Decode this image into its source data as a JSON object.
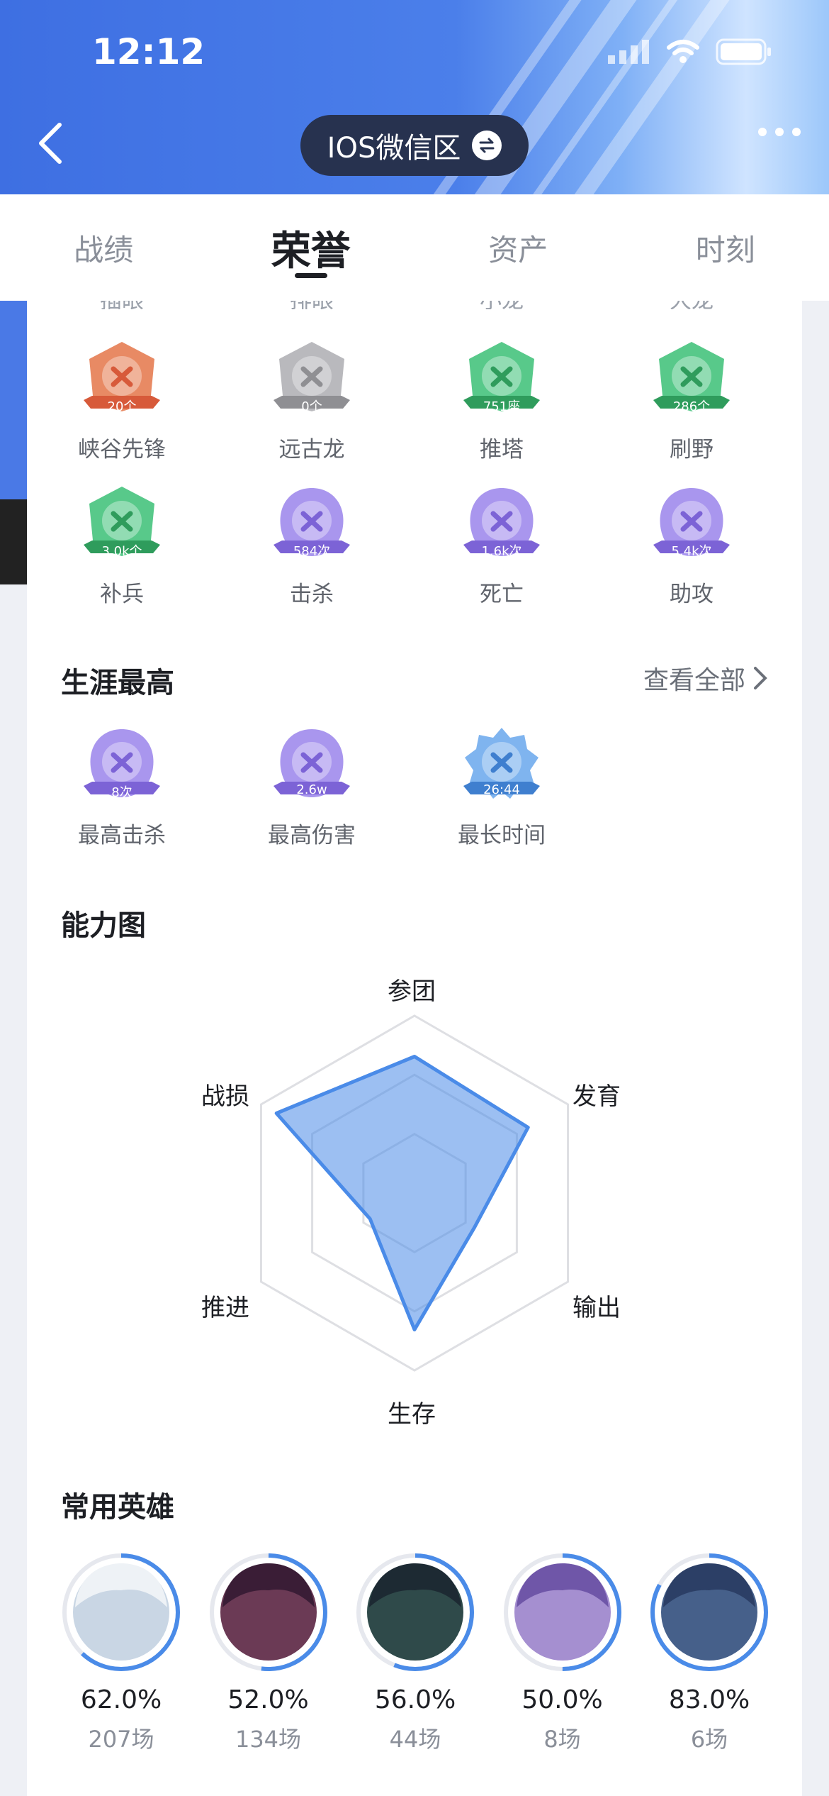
{
  "status_bar": {
    "time": "12:12",
    "icons": [
      "signal-icon",
      "wifi-icon",
      "battery-icon"
    ]
  },
  "header": {
    "region": "IOS微信区",
    "back_icon": "chevron-left-icon",
    "swap_icon": "swap-icon",
    "more_icon": "more-icon"
  },
  "tabs": [
    {
      "label": "战绩",
      "active": false
    },
    {
      "label": "荣誉",
      "active": true
    },
    {
      "label": "资产",
      "active": false
    },
    {
      "label": "时刻",
      "active": false
    }
  ],
  "cut_off_labels": [
    "插眼",
    "排眼",
    "小龙",
    "大龙"
  ],
  "badges_row1": [
    {
      "count": "20个",
      "label": "峡谷先锋",
      "icon": "herald-icon",
      "color": "#e88a64",
      "ribbon": "#d75a3a"
    },
    {
      "count": "0个",
      "label": "远古龙",
      "icon": "dragon-icon",
      "color": "#b9b9bd",
      "ribbon": "#8f8f93"
    },
    {
      "count": "751座",
      "label": "推塔",
      "icon": "tower-icon",
      "color": "#58c98a",
      "ribbon": "#2f9c5c"
    },
    {
      "count": "286个",
      "label": "刷野",
      "icon": "jungle-icon",
      "color": "#58c98a",
      "ribbon": "#2f9c5c"
    }
  ],
  "badges_row2": [
    {
      "count": "3.0k个",
      "label": "补兵",
      "icon": "minion-icon",
      "color": "#58c98a",
      "ribbon": "#2f9c5c"
    },
    {
      "count": "584次",
      "label": "击杀",
      "icon": "swords-icon",
      "color": "#a996ee",
      "ribbon": "#7c63d6"
    },
    {
      "count": "1.6k次",
      "label": "死亡",
      "icon": "skull-icon",
      "color": "#a996ee",
      "ribbon": "#7c63d6"
    },
    {
      "count": "5.4k次",
      "label": "助攻",
      "icon": "assist-icon",
      "color": "#a996ee",
      "ribbon": "#7c63d6"
    }
  ],
  "career_best": {
    "title": "生涯最高",
    "see_all": "查看全部",
    "items": [
      {
        "count": "8次",
        "label": "最高击杀",
        "icon": "swords-icon",
        "color": "#a996ee",
        "ribbon": "#7c63d6"
      },
      {
        "count": "2.6w",
        "label": "最高伤害",
        "icon": "sword-drop-icon",
        "color": "#a996ee",
        "ribbon": "#7c63d6"
      },
      {
        "count": "26:44",
        "label": "最长时间",
        "icon": "hourglass-icon",
        "color": "#7fb4ef",
        "ribbon": "#3f7fcf"
      }
    ]
  },
  "ability": {
    "title": "能力图",
    "axes": [
      "参团",
      "发育",
      "输出",
      "生存",
      "推进",
      "战损"
    ],
    "values": [
      0.77,
      0.74,
      0.39,
      0.77,
      0.29,
      0.9
    ],
    "color": "#4a8be8"
  },
  "heroes": {
    "title": "常用英雄",
    "list": [
      {
        "rate": "62.0%",
        "games": "207场",
        "ring": 0.62,
        "skin": "#c9d6e4",
        "hair": "#eef2f6"
      },
      {
        "rate": "52.0%",
        "games": "134场",
        "ring": 0.52,
        "skin": "#6b3a55",
        "hair": "#3a1d36"
      },
      {
        "rate": "56.0%",
        "games": "44场",
        "ring": 0.56,
        "skin": "#2f4a4a",
        "hair": "#1d2a33"
      },
      {
        "rate": "50.0%",
        "games": "8场",
        "ring": 0.5,
        "skin": "#a58fd0",
        "hair": "#6f56a8"
      },
      {
        "rate": "83.0%",
        "games": "6场",
        "ring": 0.83,
        "skin": "#46608a",
        "hair": "#2c3f66"
      }
    ]
  }
}
